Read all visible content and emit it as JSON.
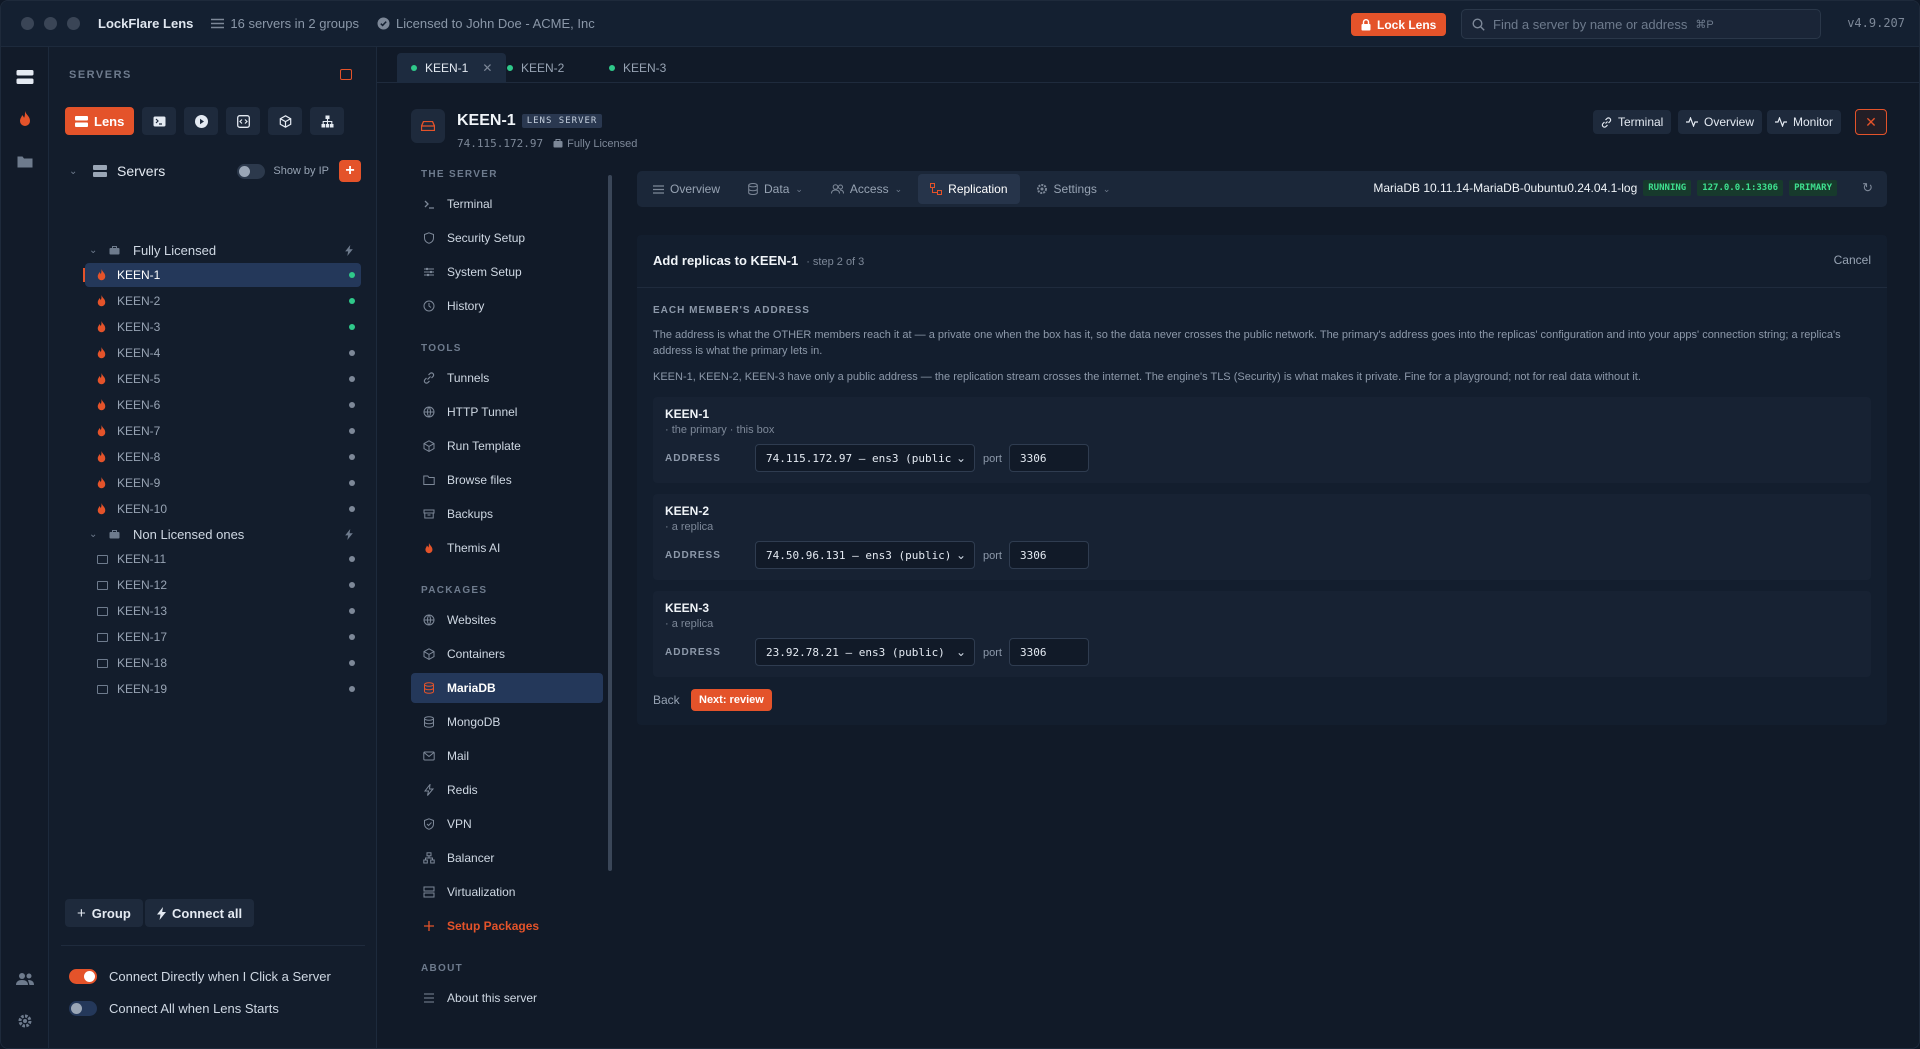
{
  "titlebar": {
    "app_name": "LockFlare Lens",
    "servers_summary": "16 servers in 2 groups",
    "license": "Licensed to John Doe - ACME, Inc",
    "lock_label": "Lock Lens",
    "search_placeholder": "Find a server by name or address",
    "search_shortcut": "⌘P",
    "version": "v4.9.207"
  },
  "sidebar": {
    "heading": "SERVERS",
    "mode_active": "Lens",
    "root_label": "Servers",
    "show_by_ip": "Show by IP",
    "groups": [
      {
        "name": "Fully Licensed",
        "servers": [
          {
            "name": "KEEN-1",
            "online": true,
            "selected": true
          },
          {
            "name": "KEEN-2",
            "online": true
          },
          {
            "name": "KEEN-3",
            "online": true
          },
          {
            "name": "KEEN-4",
            "online": false
          },
          {
            "name": "KEEN-5",
            "online": false
          },
          {
            "name": "KEEN-6",
            "online": false
          },
          {
            "name": "KEEN-7",
            "online": false
          },
          {
            "name": "KEEN-8",
            "online": false
          },
          {
            "name": "KEEN-9",
            "online": false
          },
          {
            "name": "KEEN-10",
            "online": false
          }
        ]
      },
      {
        "name": "Non Licensed ones",
        "servers": [
          {
            "name": "KEEN-11",
            "online": false
          },
          {
            "name": "KEEN-12",
            "online": false
          },
          {
            "name": "KEEN-13",
            "online": false
          },
          {
            "name": "KEEN-17",
            "online": false
          },
          {
            "name": "KEEN-18",
            "online": false
          },
          {
            "name": "KEEN-19",
            "online": false
          }
        ]
      }
    ],
    "group_button": "Group",
    "connect_all_button": "Connect all",
    "opt_connect_direct": "Connect Directly when I Click a Server",
    "opt_connect_direct_on": true,
    "opt_connect_all": "Connect All when Lens Starts",
    "opt_connect_all_on": false
  },
  "tabs": [
    {
      "label": "KEEN-1",
      "active": true
    },
    {
      "label": "KEEN-2",
      "active": false
    },
    {
      "label": "KEEN-3",
      "active": false
    }
  ],
  "server": {
    "name": "KEEN-1",
    "badge": "LENS SERVER",
    "ip": "74.115.172.97",
    "license": "Fully Licensed",
    "buttons": {
      "terminal": "Terminal",
      "overview": "Overview",
      "monitor": "Monitor"
    }
  },
  "menu": {
    "sections": {
      "server": "THE SERVER",
      "tools": "TOOLS",
      "packages": "PACKAGES",
      "about": "ABOUT"
    },
    "server_items": [
      "Terminal",
      "Security Setup",
      "System Setup",
      "History"
    ],
    "tools_items": [
      "Tunnels",
      "HTTP Tunnel",
      "Run Template",
      "Browse files",
      "Backups",
      "Themis AI"
    ],
    "packages_items": [
      "Websites",
      "Containers",
      "MariaDB",
      "MongoDB",
      "Mail",
      "Redis",
      "VPN",
      "Balancer",
      "Virtualization",
      "Setup Packages"
    ],
    "about_items": [
      "About this server"
    ],
    "selected": "MariaDB"
  },
  "panel": {
    "tabs": [
      "Overview",
      "Data",
      "Access",
      "Replication",
      "Settings"
    ],
    "active_tab": "Replication",
    "db_version": "MariaDB 10.11.14-MariaDB-0ubuntu0.24.04.1-log",
    "status": "RUNNING",
    "endpoint": "127.0.0.1:3306",
    "role": "PRIMARY"
  },
  "wizard": {
    "title": "Add replicas to KEEN-1",
    "step": "· step 2 of 3",
    "cancel": "Cancel",
    "section": "EACH MEMBER'S ADDRESS",
    "para1": "The address is what the OTHER members reach it at — a private one when the box has it, so the data never crosses the public network. The primary's address goes into the replicas' configuration and into your apps' connection string; a replica's address is what the primary lets in.",
    "para2": "KEEN-1, KEEN-2, KEEN-3 have only a public address — the replication stream crosses the internet. The engine's TLS (Security) is what makes it private. Fine for a playground; not for real data without it.",
    "address_label": "ADDRESS",
    "port_label": "port",
    "members": [
      {
        "name": "KEEN-1",
        "desc": "· the primary · this box",
        "address": "74.115.172.97 — ens3 (public)",
        "port": "3306"
      },
      {
        "name": "KEEN-2",
        "desc": "· a replica",
        "address": "74.50.96.131 — ens3 (public)",
        "port": "3306"
      },
      {
        "name": "KEEN-3",
        "desc": "· a replica",
        "address": "23.92.78.21 — ens3 (public)",
        "port": "3306"
      }
    ],
    "back": "Back",
    "next": "Next: review"
  }
}
